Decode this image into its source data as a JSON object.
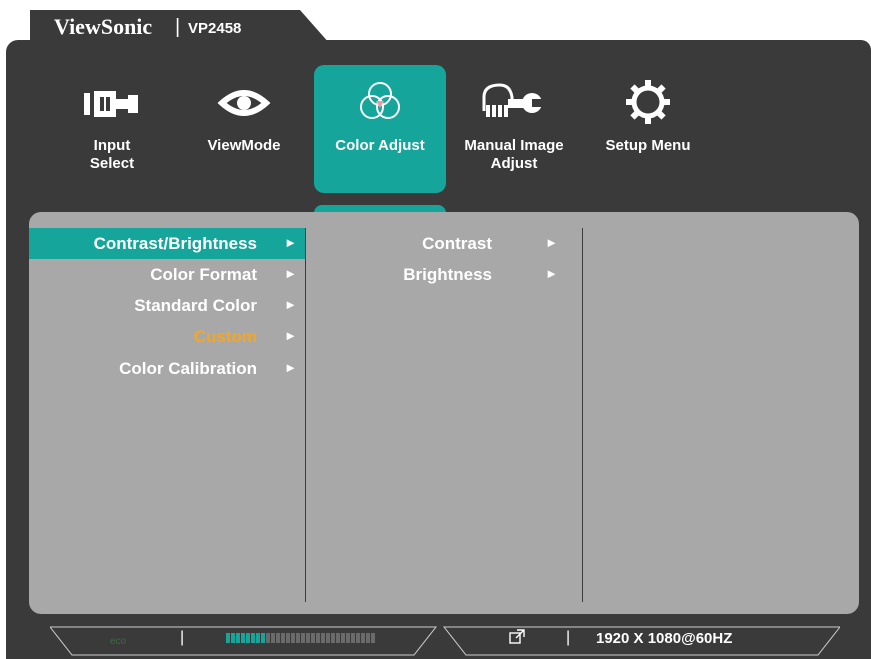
{
  "header": {
    "brand": "ViewSonic",
    "separator": "|",
    "model": "VP2458"
  },
  "top_menu": [
    {
      "label": "Input\nSelect",
      "icon": "input-select-icon",
      "active": false
    },
    {
      "label": "ViewMode",
      "icon": "eye-icon",
      "active": false
    },
    {
      "label": "Color Adjust",
      "icon": "color-circles-icon",
      "active": true
    },
    {
      "label": "Manual Image\nAdjust",
      "icon": "hand-wrench-icon",
      "active": false
    },
    {
      "label": "Setup Menu",
      "icon": "gear-icon",
      "active": false
    }
  ],
  "submenu": [
    {
      "label": "Contrast/Brightness",
      "arrow": "►",
      "active": true
    },
    {
      "label": "Color Format",
      "arrow": "►"
    },
    {
      "label": "Standard Color",
      "arrow": "►"
    },
    {
      "label": "Custom",
      "arrow": "►",
      "highlight": true
    },
    {
      "label": "Color Calibration",
      "arrow": "►"
    }
  ],
  "subsubmenu": [
    {
      "label": "Contrast",
      "arrow": "►"
    },
    {
      "label": "Brightness",
      "arrow": "►"
    }
  ],
  "status": {
    "eco_label": "eco",
    "separator": "|",
    "meter_level": 0.25,
    "resolution": "1920 X 1080@60HZ"
  },
  "colors": {
    "accent": "#15a59a",
    "frame": "#3a3a3a",
    "panel": "#a8a8a8",
    "highlight": "#f5a623"
  }
}
